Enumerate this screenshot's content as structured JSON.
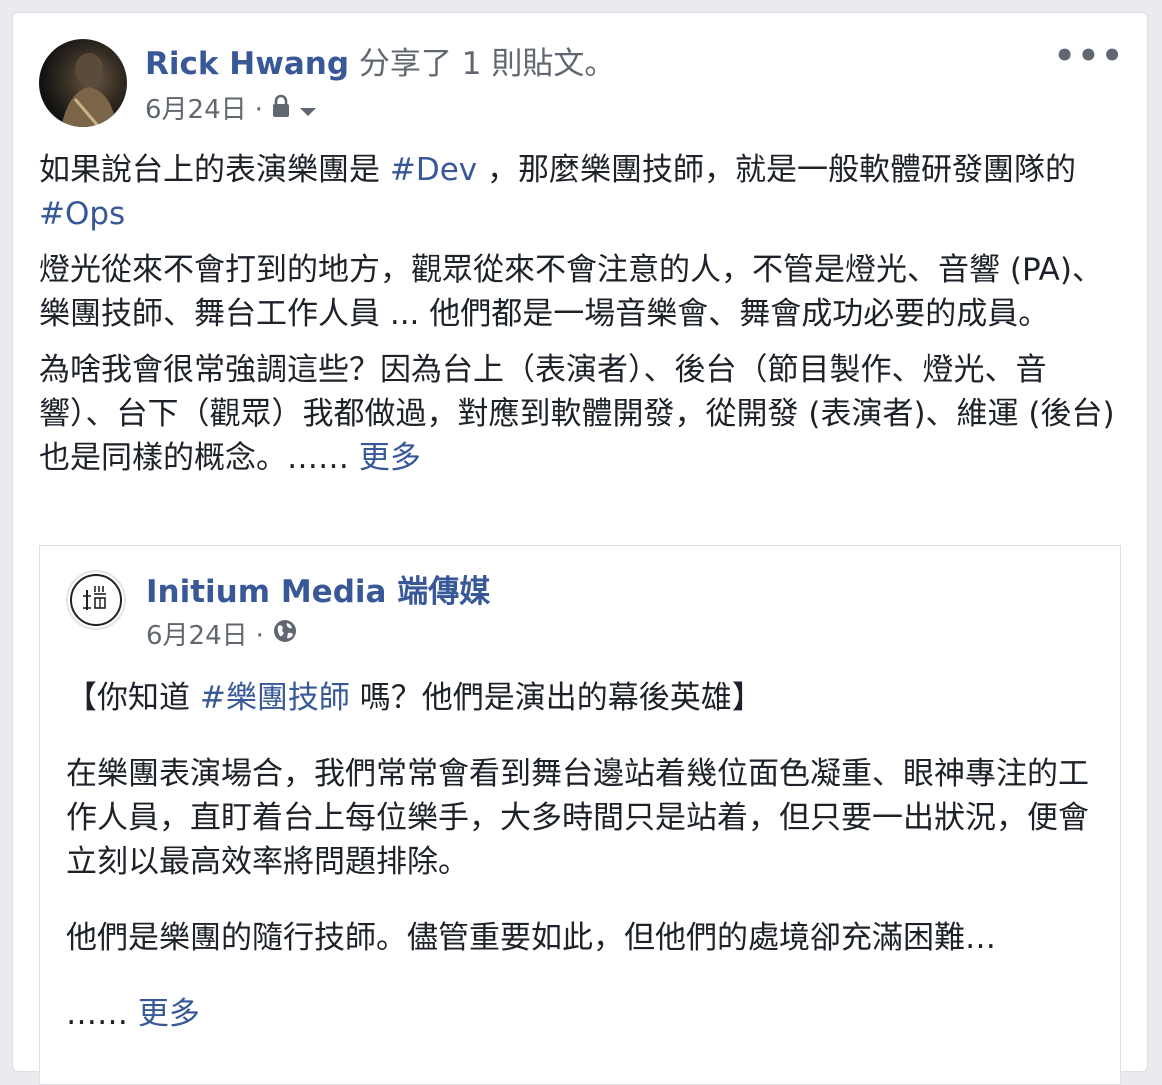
{
  "post": {
    "author": "Rick Hwang",
    "action": " 分享了 1 則貼文。",
    "date": "6月24日",
    "separator": "·",
    "more_menu": "•••",
    "paragraphs": {
      "p1_a": "如果說台上的表演樂團是 ",
      "p1_tag1": "#Dev",
      "p1_b": " ，那麼樂團技師，就是一般軟體研發團隊的 ",
      "p1_tag2": "#Ops",
      "p2": "燈光從來不會打到的地方，觀眾從來不會注意的人，不管是燈光、音響 (PA)、樂團技師、舞台工作人員 ... 他們都是一場音樂會、舞會成功必要的成員。",
      "p3": "為啥我會很常強調這些？因為台上（表演者）、後台（節目製作、燈光、音響）、台下（觀眾）我都做過，對應到軟體開發，從開發 (表演者)、維運 (後台) 也是同樣的概念。…… ",
      "p3_more": "更多"
    }
  },
  "shared_post": {
    "page_name": "Initium Media 端傳媒",
    "date": "6月24日",
    "separator": "·",
    "title_a": "【你知道 ",
    "title_tag": "#樂團技師",
    "title_b": " 嗎？他們是演出的幕後英雄】",
    "p1": "在樂團表演場合，我們常常會看到舞台邊站着幾位面色凝重、眼神專注的工作人員，直盯着台上每位樂手，大多時間只是站着，但只要一出狀況，便會立刻以最高效率將問題排除。",
    "p2": "他們是樂團的隨行技師。儘管重要如此，但他們的處境卻充滿困難…",
    "ellipsis": "…… ",
    "more": "更多"
  },
  "icons": {
    "privacy": "lock-icon",
    "audience_dropdown": "chevron-down-icon",
    "shared_privacy": "globe-icon"
  },
  "colors": {
    "link": "#385898",
    "meta": "#616770",
    "text": "#1d2129"
  }
}
